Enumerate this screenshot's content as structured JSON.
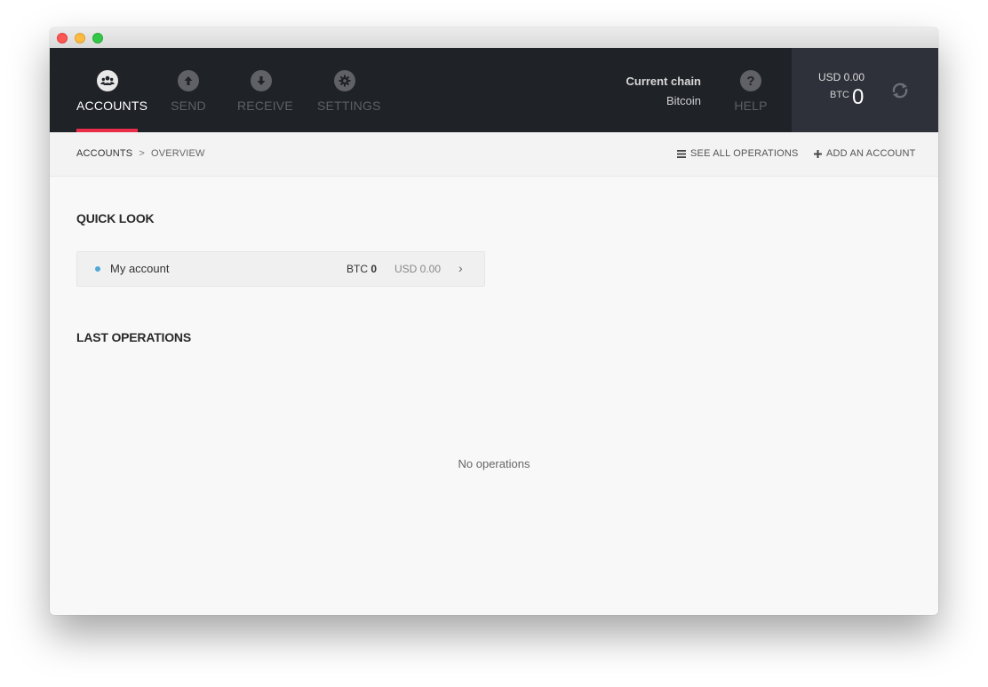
{
  "nav": {
    "items": [
      {
        "label": "ACCOUNTS",
        "icon": "accounts-icon",
        "active": true
      },
      {
        "label": "SEND",
        "icon": "arrow-up-icon",
        "active": false
      },
      {
        "label": "RECEIVE",
        "icon": "arrow-down-icon",
        "active": false
      },
      {
        "label": "SETTINGS",
        "icon": "gear-icon",
        "active": false
      }
    ],
    "accent": "#ea2e49"
  },
  "chain": {
    "title": "Current chain",
    "name": "Bitcoin"
  },
  "help": {
    "label": "HELP",
    "icon": "question-icon"
  },
  "balance": {
    "usd": "USD 0.00",
    "btc_label": "BTC",
    "btc_value": "0"
  },
  "breadcrumb": {
    "root": "ACCOUNTS",
    "separator": ">",
    "current": "OVERVIEW"
  },
  "actions": {
    "see_all": "SEE ALL OPERATIONS",
    "add_account": "ADD AN ACCOUNT"
  },
  "quick_look": {
    "title": "QUICK LOOK",
    "accounts": [
      {
        "name": "My account",
        "btc_label": "BTC",
        "btc_value": "0",
        "usd": "USD 0.00",
        "dot_color": "#4fa8d6"
      }
    ]
  },
  "last_operations": {
    "title": "LAST OPERATIONS",
    "empty_text": "No operations"
  }
}
